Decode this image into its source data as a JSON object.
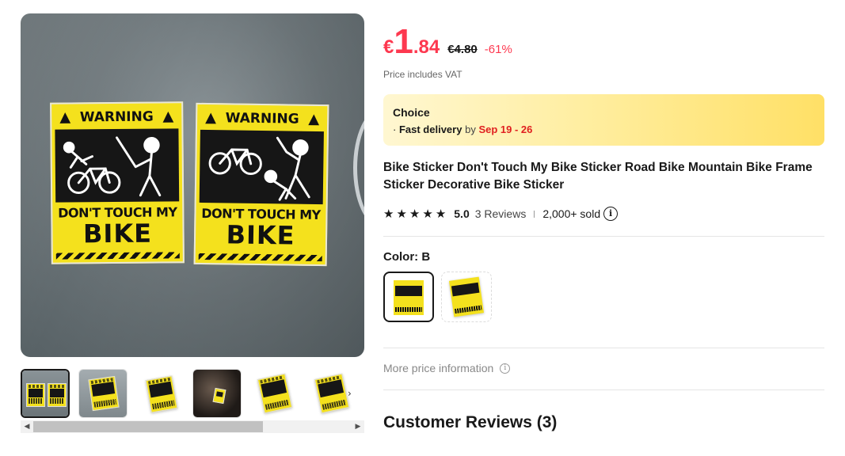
{
  "price": {
    "currency": "€",
    "integer": "1",
    "decimal": ".84",
    "original": "€4.80",
    "discount": "-61%",
    "vat_note": "Price includes VAT"
  },
  "choice": {
    "title": "Choice",
    "bullet": "·",
    "fast_delivery": "Fast delivery",
    "by": "by",
    "date_range": "Sep 19 - 26"
  },
  "product": {
    "title": "Bike Sticker Don't Touch My Bike Sticker Road Bike Mountain Bike Frame Sticker Decorative Bike Sticker"
  },
  "rating": {
    "stars": 5,
    "score": "5.0",
    "reviews": "3 Reviews",
    "sold": "2,000+ sold"
  },
  "color": {
    "label": "Color: B",
    "selected_index": 0
  },
  "more_price": {
    "label": "More price information"
  },
  "customer_reviews": {
    "heading": "Customer Reviews (3)"
  },
  "gallery": {
    "sticker_text": {
      "warning": "WARNING",
      "line1": "DON'T TOUCH MY",
      "line2": "BIKE"
    },
    "thumbnail_count": 6,
    "active_thumbnail": 0
  },
  "icons": {
    "star": "★",
    "info": "i",
    "warning_triangle": "▲",
    "chevron_right": "›",
    "scroll_left": "◀",
    "scroll_right": "▶"
  },
  "colors": {
    "price_red": "#fd384f",
    "delivery_red": "#e02020",
    "sticker_yellow": "#f4e11d",
    "choice_gradient_end": "#ffe066"
  }
}
